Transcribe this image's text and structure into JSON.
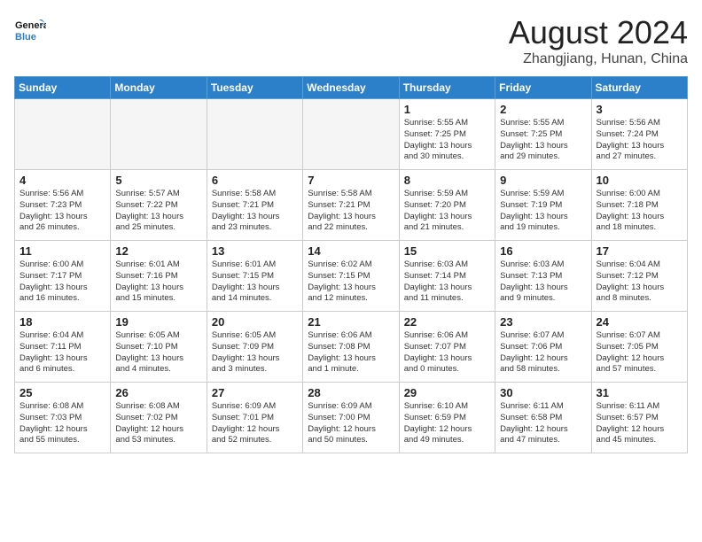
{
  "header": {
    "logo_line1": "General",
    "logo_line2": "Blue",
    "month": "August 2024",
    "location": "Zhangjiang, Hunan, China"
  },
  "days_of_week": [
    "Sunday",
    "Monday",
    "Tuesday",
    "Wednesday",
    "Thursday",
    "Friday",
    "Saturday"
  ],
  "weeks": [
    [
      {
        "day": "",
        "info": ""
      },
      {
        "day": "",
        "info": ""
      },
      {
        "day": "",
        "info": ""
      },
      {
        "day": "",
        "info": ""
      },
      {
        "day": "1",
        "info": "Sunrise: 5:55 AM\nSunset: 7:25 PM\nDaylight: 13 hours\nand 30 minutes."
      },
      {
        "day": "2",
        "info": "Sunrise: 5:55 AM\nSunset: 7:25 PM\nDaylight: 13 hours\nand 29 minutes."
      },
      {
        "day": "3",
        "info": "Sunrise: 5:56 AM\nSunset: 7:24 PM\nDaylight: 13 hours\nand 27 minutes."
      }
    ],
    [
      {
        "day": "4",
        "info": "Sunrise: 5:56 AM\nSunset: 7:23 PM\nDaylight: 13 hours\nand 26 minutes."
      },
      {
        "day": "5",
        "info": "Sunrise: 5:57 AM\nSunset: 7:22 PM\nDaylight: 13 hours\nand 25 minutes."
      },
      {
        "day": "6",
        "info": "Sunrise: 5:58 AM\nSunset: 7:21 PM\nDaylight: 13 hours\nand 23 minutes."
      },
      {
        "day": "7",
        "info": "Sunrise: 5:58 AM\nSunset: 7:21 PM\nDaylight: 13 hours\nand 22 minutes."
      },
      {
        "day": "8",
        "info": "Sunrise: 5:59 AM\nSunset: 7:20 PM\nDaylight: 13 hours\nand 21 minutes."
      },
      {
        "day": "9",
        "info": "Sunrise: 5:59 AM\nSunset: 7:19 PM\nDaylight: 13 hours\nand 19 minutes."
      },
      {
        "day": "10",
        "info": "Sunrise: 6:00 AM\nSunset: 7:18 PM\nDaylight: 13 hours\nand 18 minutes."
      }
    ],
    [
      {
        "day": "11",
        "info": "Sunrise: 6:00 AM\nSunset: 7:17 PM\nDaylight: 13 hours\nand 16 minutes."
      },
      {
        "day": "12",
        "info": "Sunrise: 6:01 AM\nSunset: 7:16 PM\nDaylight: 13 hours\nand 15 minutes."
      },
      {
        "day": "13",
        "info": "Sunrise: 6:01 AM\nSunset: 7:15 PM\nDaylight: 13 hours\nand 14 minutes."
      },
      {
        "day": "14",
        "info": "Sunrise: 6:02 AM\nSunset: 7:15 PM\nDaylight: 13 hours\nand 12 minutes."
      },
      {
        "day": "15",
        "info": "Sunrise: 6:03 AM\nSunset: 7:14 PM\nDaylight: 13 hours\nand 11 minutes."
      },
      {
        "day": "16",
        "info": "Sunrise: 6:03 AM\nSunset: 7:13 PM\nDaylight: 13 hours\nand 9 minutes."
      },
      {
        "day": "17",
        "info": "Sunrise: 6:04 AM\nSunset: 7:12 PM\nDaylight: 13 hours\nand 8 minutes."
      }
    ],
    [
      {
        "day": "18",
        "info": "Sunrise: 6:04 AM\nSunset: 7:11 PM\nDaylight: 13 hours\nand 6 minutes."
      },
      {
        "day": "19",
        "info": "Sunrise: 6:05 AM\nSunset: 7:10 PM\nDaylight: 13 hours\nand 4 minutes."
      },
      {
        "day": "20",
        "info": "Sunrise: 6:05 AM\nSunset: 7:09 PM\nDaylight: 13 hours\nand 3 minutes."
      },
      {
        "day": "21",
        "info": "Sunrise: 6:06 AM\nSunset: 7:08 PM\nDaylight: 13 hours\nand 1 minute."
      },
      {
        "day": "22",
        "info": "Sunrise: 6:06 AM\nSunset: 7:07 PM\nDaylight: 13 hours\nand 0 minutes."
      },
      {
        "day": "23",
        "info": "Sunrise: 6:07 AM\nSunset: 7:06 PM\nDaylight: 12 hours\nand 58 minutes."
      },
      {
        "day": "24",
        "info": "Sunrise: 6:07 AM\nSunset: 7:05 PM\nDaylight: 12 hours\nand 57 minutes."
      }
    ],
    [
      {
        "day": "25",
        "info": "Sunrise: 6:08 AM\nSunset: 7:03 PM\nDaylight: 12 hours\nand 55 minutes."
      },
      {
        "day": "26",
        "info": "Sunrise: 6:08 AM\nSunset: 7:02 PM\nDaylight: 12 hours\nand 53 minutes."
      },
      {
        "day": "27",
        "info": "Sunrise: 6:09 AM\nSunset: 7:01 PM\nDaylight: 12 hours\nand 52 minutes."
      },
      {
        "day": "28",
        "info": "Sunrise: 6:09 AM\nSunset: 7:00 PM\nDaylight: 12 hours\nand 50 minutes."
      },
      {
        "day": "29",
        "info": "Sunrise: 6:10 AM\nSunset: 6:59 PM\nDaylight: 12 hours\nand 49 minutes."
      },
      {
        "day": "30",
        "info": "Sunrise: 6:11 AM\nSunset: 6:58 PM\nDaylight: 12 hours\nand 47 minutes."
      },
      {
        "day": "31",
        "info": "Sunrise: 6:11 AM\nSunset: 6:57 PM\nDaylight: 12 hours\nand 45 minutes."
      }
    ]
  ]
}
